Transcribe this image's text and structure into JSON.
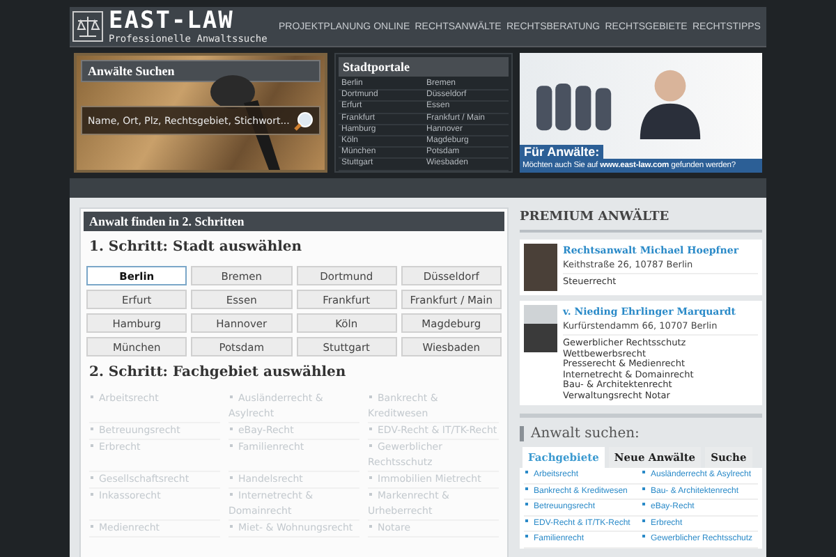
{
  "logo": {
    "title": "EAST-LAW",
    "subtitle": "Professionelle Anwaltssuche"
  },
  "nav": [
    "PROJEKTPLANUNG ONLINE",
    "RECHTSANWÄLTE",
    "RECHTSBERATUNG",
    "RECHTSGEBIETE",
    "RECHTSTIPPS"
  ],
  "search_panel": {
    "title": "Anwälte Suchen",
    "placeholder": "Name, Ort, Plz, Rechtsgebiet, Stichwort..."
  },
  "city_portals": {
    "title": "Stadtportale",
    "cities": [
      "Berlin",
      "Bremen",
      "Dortmund",
      "Düsseldorf",
      "Erfurt",
      "Essen",
      "Frankfurt",
      "Frankfurt / Main",
      "Hamburg",
      "Hannover",
      "Köln",
      "Magdeburg",
      "München",
      "Potsdam",
      "Stuttgart",
      "Wiesbaden"
    ]
  },
  "ad": {
    "heading": "Für Anwälte:",
    "text": "Möchten auch Sie auf **www.east-law.com** gefunden werden?"
  },
  "finder": {
    "title": "Anwalt finden in 2. Schritten",
    "step1": "1. Schritt: Stadt auswählen",
    "step2": "2. Schritt: Fachgebiet auswählen",
    "cities": [
      {
        "label": "Berlin",
        "selected": true
      },
      {
        "label": "Bremen",
        "selected": false
      },
      {
        "label": "Dortmund",
        "selected": false
      },
      {
        "label": "Düsseldorf",
        "selected": false
      },
      {
        "label": "Erfurt",
        "selected": false
      },
      {
        "label": "Essen",
        "selected": false
      },
      {
        "label": "Frankfurt",
        "selected": false
      },
      {
        "label": "Frankfurt / Main",
        "selected": false
      },
      {
        "label": "Hamburg",
        "selected": false
      },
      {
        "label": "Hannover",
        "selected": false
      },
      {
        "label": "Köln",
        "selected": false
      },
      {
        "label": "Magdeburg",
        "selected": false
      },
      {
        "label": "München",
        "selected": false
      },
      {
        "label": "Potsdam",
        "selected": false
      },
      {
        "label": "Stuttgart",
        "selected": false
      },
      {
        "label": "Wiesbaden",
        "selected": false
      }
    ],
    "areas": [
      "Arbeitsrecht",
      "Ausländerrecht & Asylrecht",
      "Bankrecht & Kreditwesen",
      "Betreuungsrecht",
      "eBay-Recht",
      "EDV-Recht & IT/TK-Recht",
      "Erbrecht",
      "Familienrecht",
      "Gewerblicher Rechtsschutz",
      "Gesellschaftsrecht",
      "Handelsrecht",
      "Immobilien Mietrecht",
      "Inkassorecht",
      "Internetrecht & Domainrecht",
      "Markenrecht & Urheberrecht",
      "Medienrecht",
      "Miet- & Wohnungsrecht",
      "Notare"
    ]
  },
  "premium": {
    "title": "PREMIUM ANWÄLTE",
    "lawyers": [
      {
        "name": "Rechtsanwalt Michael Hoepfner",
        "address": "Keithstraße 26, 10787 Berlin",
        "areas": [
          "Steuerrecht"
        ]
      },
      {
        "name": "v. Nieding Ehrlinger Marquardt",
        "address": "Kurfürstendamm 66, 10707 Berlin",
        "areas": [
          "Gewerblicher Rechtsschutz",
          "Wettbewerbsrecht",
          "Presserecht & Medienrecht",
          "Internetrecht & Domainrecht",
          "Bau- & Architektenrecht",
          "Verwaltungsrecht Notar"
        ]
      }
    ]
  },
  "lawyer_search": {
    "title": "Anwalt suchen:",
    "tabs": [
      {
        "label": "Fachgebiete",
        "selected": true
      },
      {
        "label": "Neue Anwälte",
        "selected": false
      },
      {
        "label": "Suche",
        "selected": false
      }
    ],
    "links": [
      "Arbeitsrecht",
      "Ausländerrecht & Asylrecht",
      "Bankrecht & Kreditwesen",
      "Bau- & Architektenrecht",
      "Betreuungsrecht",
      "eBay-Recht",
      "EDV-Recht & IT/TK-Recht",
      "Erbrecht",
      "Familienrecht",
      "Gewerblicher Rechtsschutz"
    ]
  }
}
